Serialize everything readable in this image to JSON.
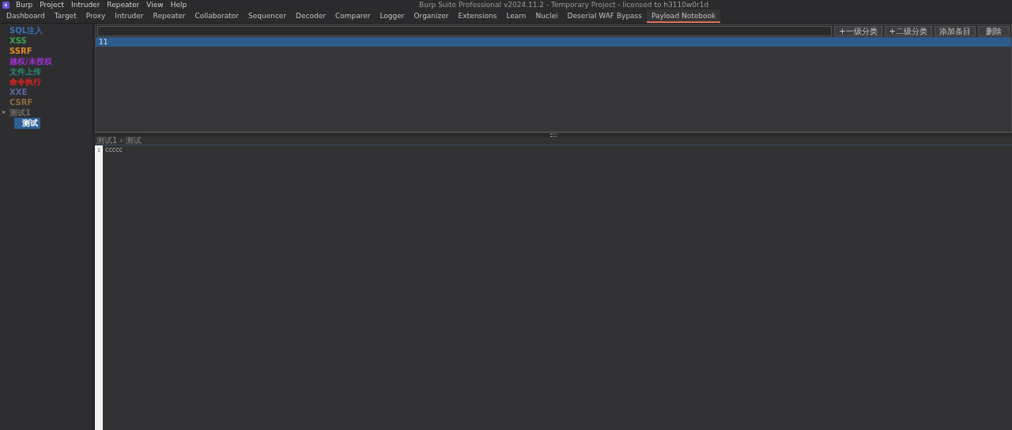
{
  "menu": [
    "Burp",
    "Project",
    "Intruder",
    "Repeater",
    "View",
    "Help"
  ],
  "window": {
    "title": "Burp Suite Professional v2024.11.2 - Temporary Project - licensed to h3110w0r1d"
  },
  "tabs": [
    {
      "label": "Dashboard",
      "selected": false
    },
    {
      "label": "Target",
      "selected": false
    },
    {
      "label": "Proxy",
      "selected": false
    },
    {
      "label": "Intruder",
      "selected": false
    },
    {
      "label": "Repeater",
      "selected": false
    },
    {
      "label": "Collaborator",
      "selected": false
    },
    {
      "label": "Sequencer",
      "selected": false
    },
    {
      "label": "Decoder",
      "selected": false
    },
    {
      "label": "Comparer",
      "selected": false
    },
    {
      "label": "Logger",
      "selected": false
    },
    {
      "label": "Organizer",
      "selected": false
    },
    {
      "label": "Extensions",
      "selected": false
    },
    {
      "label": "Learn",
      "selected": false
    },
    {
      "label": "Nuclei",
      "selected": false
    },
    {
      "label": "Deserial WAF Bypass",
      "selected": false
    },
    {
      "label": "Payload Notebook",
      "selected": true
    }
  ],
  "tree": [
    {
      "label": "SQL注入",
      "color": "#3f6fb5",
      "selected": false
    },
    {
      "label": "XSS",
      "color": "#3fa050",
      "selected": false
    },
    {
      "label": "SSRF",
      "color": "#e08a2a",
      "selected": false
    },
    {
      "label": "越权/未授权",
      "color": "#a030d0",
      "selected": false
    },
    {
      "label": "文件上传",
      "color": "#2a8a70",
      "selected": false
    },
    {
      "label": "命令执行",
      "color": "#e82020",
      "selected": false
    },
    {
      "label": "XXE",
      "color": "#5a6a9a",
      "selected": false
    },
    {
      "label": "CSRF",
      "color": "#8a6a40",
      "selected": false
    },
    {
      "label": "测试1",
      "color": "#6a6a6a",
      "selected": false,
      "expanded": true,
      "children": [
        {
          "label": "测试",
          "selected": true
        }
      ]
    }
  ],
  "buttons": [
    "+一级分类",
    "+二级分类",
    "添加条目",
    "删除"
  ],
  "entries": [
    {
      "label": "11",
      "selected": true
    }
  ],
  "breadcrumb": "测试1 › 测试",
  "editor": {
    "lines": [
      {
        "number": "1",
        "text": "ccccc"
      }
    ]
  }
}
